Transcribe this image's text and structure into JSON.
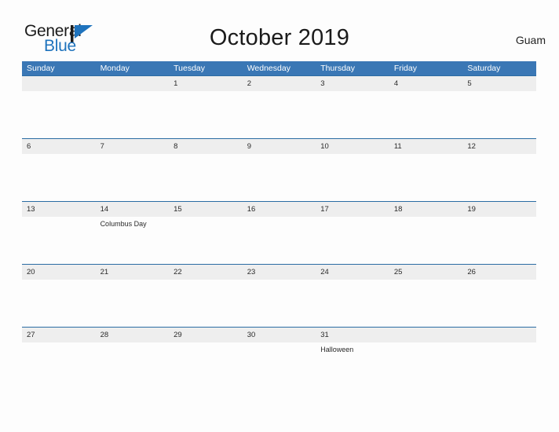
{
  "brand": {
    "name_part1": "General",
    "name_part2": "Blue",
    "mark_icon": "blue-triangle-flag-icon",
    "accent_color": "#1f73bd"
  },
  "header": {
    "title": "October 2019",
    "location": "Guam"
  },
  "calendar": {
    "header_bg_color": "#3a77b5",
    "band_bg_color": "#eeeeee",
    "rule_color": "#2b6ca3",
    "weekdays": [
      "Sunday",
      "Monday",
      "Tuesday",
      "Wednesday",
      "Thursday",
      "Friday",
      "Saturday"
    ],
    "weeks": [
      {
        "days": [
          {
            "num": "",
            "event": ""
          },
          {
            "num": "",
            "event": ""
          },
          {
            "num": "1",
            "event": ""
          },
          {
            "num": "2",
            "event": ""
          },
          {
            "num": "3",
            "event": ""
          },
          {
            "num": "4",
            "event": ""
          },
          {
            "num": "5",
            "event": ""
          }
        ]
      },
      {
        "days": [
          {
            "num": "6",
            "event": ""
          },
          {
            "num": "7",
            "event": ""
          },
          {
            "num": "8",
            "event": ""
          },
          {
            "num": "9",
            "event": ""
          },
          {
            "num": "10",
            "event": ""
          },
          {
            "num": "11",
            "event": ""
          },
          {
            "num": "12",
            "event": ""
          }
        ]
      },
      {
        "days": [
          {
            "num": "13",
            "event": ""
          },
          {
            "num": "14",
            "event": "Columbus Day"
          },
          {
            "num": "15",
            "event": ""
          },
          {
            "num": "16",
            "event": ""
          },
          {
            "num": "17",
            "event": ""
          },
          {
            "num": "18",
            "event": ""
          },
          {
            "num": "19",
            "event": ""
          }
        ]
      },
      {
        "days": [
          {
            "num": "20",
            "event": ""
          },
          {
            "num": "21",
            "event": ""
          },
          {
            "num": "22",
            "event": ""
          },
          {
            "num": "23",
            "event": ""
          },
          {
            "num": "24",
            "event": ""
          },
          {
            "num": "25",
            "event": ""
          },
          {
            "num": "26",
            "event": ""
          }
        ]
      },
      {
        "days": [
          {
            "num": "27",
            "event": ""
          },
          {
            "num": "28",
            "event": ""
          },
          {
            "num": "29",
            "event": ""
          },
          {
            "num": "30",
            "event": ""
          },
          {
            "num": "31",
            "event": "Halloween"
          },
          {
            "num": "",
            "event": ""
          },
          {
            "num": "",
            "event": ""
          }
        ]
      }
    ]
  }
}
